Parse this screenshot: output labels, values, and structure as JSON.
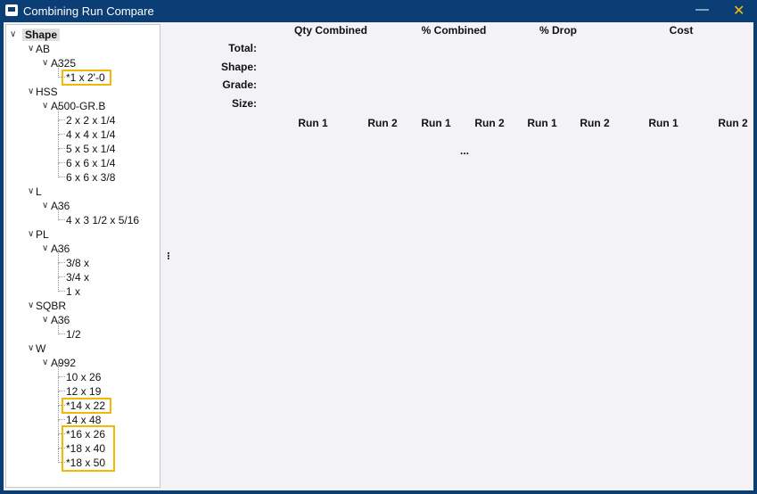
{
  "window": {
    "title": "Combining Run Compare",
    "minimize": "—",
    "close": "✕"
  },
  "tree": {
    "root": "Shape",
    "nodes": [
      {
        "label": "AB",
        "level": 1
      },
      {
        "label": "A325",
        "level": 2
      },
      {
        "label": "*1 x 2'-0",
        "level": 3,
        "highlight": true
      },
      {
        "label": "HSS",
        "level": 1
      },
      {
        "label": "A500-GR.B",
        "level": 2
      },
      {
        "label": "2 x 2 x 1/4",
        "level": 3
      },
      {
        "label": "4 x 4 x 1/4",
        "level": 3
      },
      {
        "label": "5 x 5 x 1/4",
        "level": 3
      },
      {
        "label": "6 x 6 x 1/4",
        "level": 3
      },
      {
        "label": "6 x 6 x 3/8",
        "level": 3
      },
      {
        "label": "L",
        "level": 1
      },
      {
        "label": "A36",
        "level": 2
      },
      {
        "label": "4 x 3 1/2 x 5/16",
        "level": 3
      },
      {
        "label": "PL",
        "level": 1
      },
      {
        "label": "A36",
        "level": 2
      },
      {
        "label": "3/8 x",
        "level": 3
      },
      {
        "label": "3/4 x",
        "level": 3
      },
      {
        "label": "1 x",
        "level": 3
      },
      {
        "label": "SQBR",
        "level": 1
      },
      {
        "label": "A36",
        "level": 2
      },
      {
        "label": "1/2",
        "level": 3
      },
      {
        "label": "W",
        "level": 1
      },
      {
        "label": "A992",
        "level": 2
      },
      {
        "label": "10 x 26",
        "level": 3
      },
      {
        "label": "12 x 19",
        "level": 3
      },
      {
        "label": "*14 x 22",
        "level": 3,
        "highlight": true
      },
      {
        "label": "14 x 48",
        "level": 3
      },
      {
        "label": "*16 x 26",
        "level": 3,
        "group": true
      },
      {
        "label": "*18 x 40",
        "level": 3,
        "group": true
      },
      {
        "label": "*18 x 50",
        "level": 3,
        "group": true
      }
    ]
  },
  "compare": {
    "columns": [
      "Qty Combined",
      "% Combined",
      "% Drop",
      "Cost"
    ],
    "row_labels": [
      "Total:",
      "Shape:",
      "Grade:",
      "Size:"
    ],
    "runs": [
      "Run 1",
      "Run 2",
      "Run 1",
      "Run 2",
      "Run 1",
      "Run 2",
      "Run 1",
      "Run 2"
    ],
    "ellipsis": "...",
    "splitter": "⁝"
  }
}
